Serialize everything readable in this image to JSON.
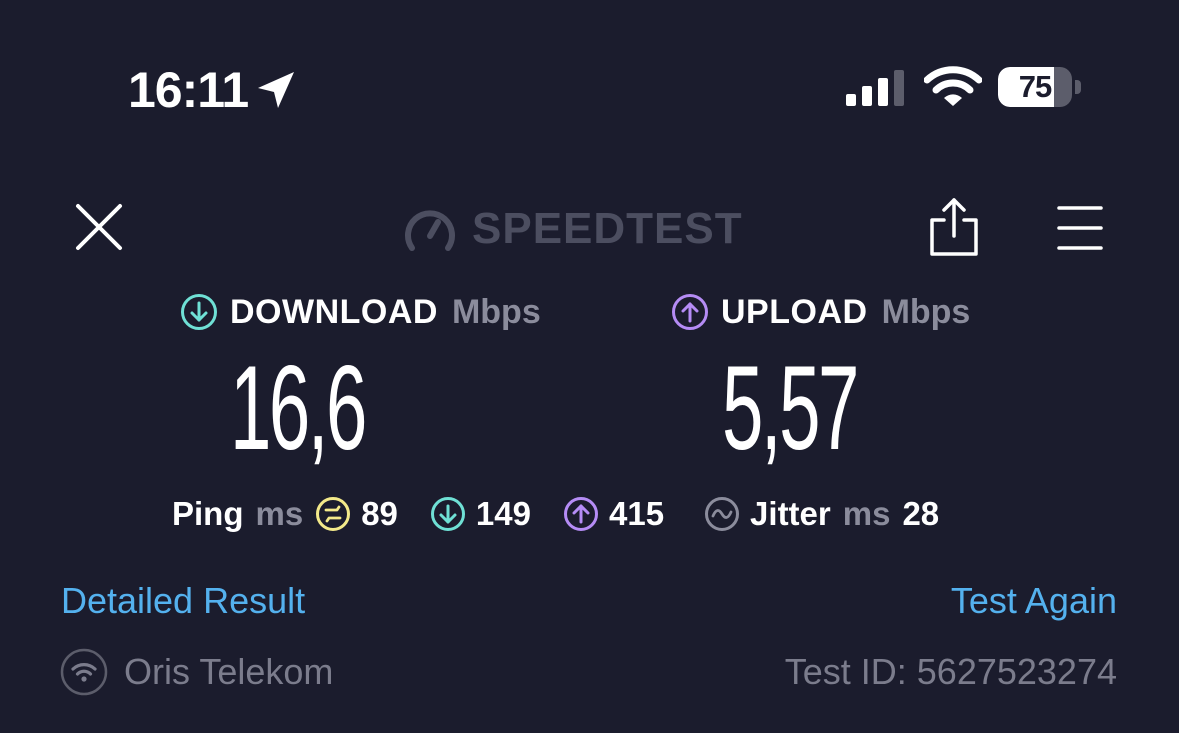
{
  "status_bar": {
    "time": "16:11",
    "battery_percent": "75",
    "battery_level": 0.75
  },
  "header": {
    "logo_text": "SPEEDTEST"
  },
  "download": {
    "label": "DOWNLOAD",
    "unit": "Mbps",
    "value": "16,6"
  },
  "upload": {
    "label": "UPLOAD",
    "unit": "Mbps",
    "value": "5,57"
  },
  "ping": {
    "label": "Ping",
    "unit": "ms",
    "idle": "89",
    "download": "149",
    "upload": "415"
  },
  "jitter": {
    "label": "Jitter",
    "unit": "ms",
    "value": "28"
  },
  "actions": {
    "detailed_result": "Detailed Result",
    "test_again": "Test Again"
  },
  "footer": {
    "provider": "Oris Telekom",
    "test_id": "Test ID: 5627523274"
  },
  "colors": {
    "background": "#1b1c2d",
    "download_accent": "#6fe0d5",
    "upload_accent": "#b58cf5",
    "ping_accent": "#f3e98a",
    "link": "#54b1ee",
    "muted": "#7b7c8c"
  },
  "icons": [
    "location-arrow-icon",
    "cellular-signal-icon",
    "wifi-icon",
    "battery-icon",
    "close-icon",
    "speedtest-gauge-icon",
    "share-icon",
    "menu-icon",
    "download-arrow-icon",
    "upload-arrow-icon",
    "idle-ping-icon",
    "jitter-icon",
    "wifi-connection-icon"
  ]
}
